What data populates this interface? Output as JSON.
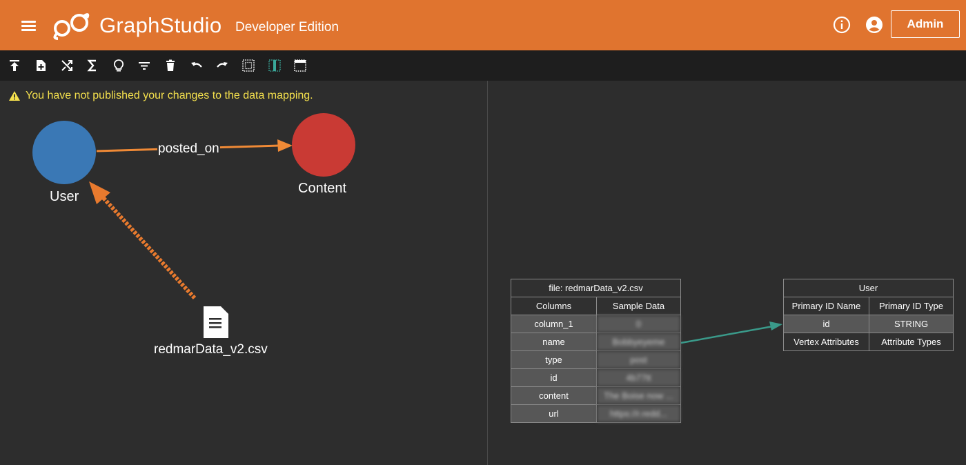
{
  "header": {
    "brand_part1": "Graph",
    "brand_part2": "Studio",
    "edition": "Developer Edition",
    "admin_label": "Admin"
  },
  "toolbar": {
    "icons": [
      "publish-icon",
      "add-file-icon",
      "shuffle-icon",
      "sigma-icon",
      "lightbulb-icon",
      "filter-icon",
      "delete-icon",
      "undo-icon",
      "redo-icon",
      "select-grid-icon",
      "select-column-icon",
      "select-row-icon"
    ]
  },
  "warning": {
    "text": "You have not published your changes to the data mapping."
  },
  "graph": {
    "nodes": [
      {
        "label": "User",
        "color": "#3a78b5"
      },
      {
        "label": "Content",
        "color": "#c93a34"
      }
    ],
    "edge_label": "posted_on",
    "file_label": "redmarData_v2.csv",
    "edge_color": "#f08a36",
    "mapping_color": "#e87a2e"
  },
  "file_table": {
    "title": "file: redmarData_v2.csv",
    "headers": [
      "Columns",
      "Sample Data"
    ],
    "rows": [
      {
        "column": "column_1",
        "sample": "0"
      },
      {
        "column": "name",
        "sample": "Bobbyeyeme"
      },
      {
        "column": "type",
        "sample": "post"
      },
      {
        "column": "id",
        "sample": "4b77tt"
      },
      {
        "column": "content",
        "sample": "The Boise now ..."
      },
      {
        "column": "url",
        "sample": "https://r.redd..."
      }
    ]
  },
  "vertex_table": {
    "title": "User",
    "headers": [
      "Primary ID Name",
      "Primary ID Type"
    ],
    "id_row": [
      "id",
      "STRING"
    ],
    "attr_headers": [
      "Vertex Attributes",
      "Attribute Types"
    ]
  },
  "mapping_arrow_color": "#3a9a8a"
}
